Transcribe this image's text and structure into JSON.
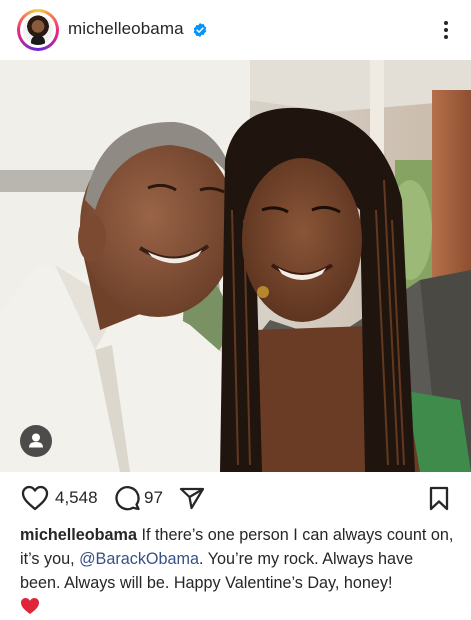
{
  "post": {
    "username": "michelleobama",
    "verified": true,
    "likes": "4,548",
    "comments": "97",
    "caption": {
      "username": "michelleobama",
      "text_before": "If there’s one person I can always count on, it’s you,",
      "mention": "@BarackObama",
      "text_after": ". You’re my rock. Always have been. Always will be. Happy Valentine’s Day, honey!",
      "emoji": "red-heart"
    }
  },
  "icons": {
    "verified": "verified-badge-icon",
    "more": "more-options-icon",
    "like": "heart-icon",
    "comment": "comment-icon",
    "share": "share-icon",
    "save": "bookmark-icon",
    "tag": "tagged-user-icon"
  },
  "colors": {
    "verified_blue": "#0095f6",
    "mention": "#385185",
    "text": "#262626",
    "emoji_heart": "#e0243a"
  }
}
